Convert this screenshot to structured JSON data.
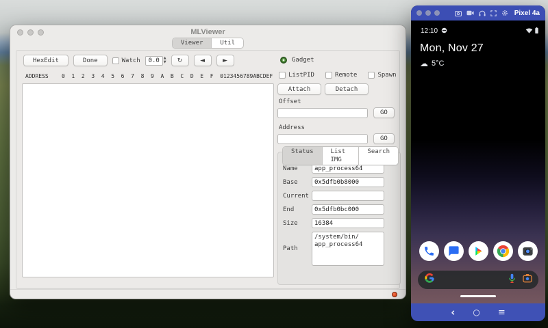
{
  "mlviewer": {
    "title": "MLViewer",
    "tabs": {
      "viewer": "Viewer",
      "util": "Util"
    },
    "toolbar": {
      "hexedit": "HexEdit",
      "done": "Done",
      "watch_label": "Watch",
      "watch_value": "0.0"
    },
    "icons": {
      "refresh": "↻",
      "prev": "◄",
      "next": "►",
      "spin_up": "▲",
      "spin_down": "▼"
    },
    "hex_header": "ADDRESS    0  1  2  3  4  5  6  7  8  9  A  B  C  D  E  F  0123456789ABCDEF",
    "util": {
      "gadget_label": "Gadget",
      "checkboxes": {
        "listpid": "ListPID",
        "remote": "Remote",
        "spawn": "Spawn"
      },
      "attach": "Attach",
      "detach": "Detach",
      "offset_label": "Offset",
      "offset_value": "",
      "offset_go": "GO",
      "address_label": "Address",
      "address_value": "",
      "address_go": "GO",
      "tabs": {
        "status": "Status",
        "list_img": "List IMG",
        "search": "Search"
      },
      "fields": {
        "name": {
          "label": "Name",
          "value": "app_process64"
        },
        "base": {
          "label": "Base",
          "value": "0x5dfb0b8000"
        },
        "current": {
          "label": "Current",
          "value": ""
        },
        "end": {
          "label": "End",
          "value": "0x5dfb0bc000"
        },
        "size": {
          "label": "Size",
          "value": "16384"
        },
        "path": {
          "label": "Path",
          "value": "/system/bin/\napp_process64"
        }
      }
    }
  },
  "phone": {
    "device_name": "Pixel 4a",
    "status": {
      "time": "12:10"
    },
    "home": {
      "date": "Mon, Nov 27",
      "weather_icon": "☁",
      "temperature": "5°C"
    },
    "nav": {
      "back": "‹",
      "home": "○",
      "menu": "≡"
    },
    "colors": {
      "titlebar_blue": "#3c4eb4",
      "navbar_blue": "#3f51b5",
      "status_dot_red": "#e04a1f",
      "gadget_green": "#5a9b43"
    }
  }
}
